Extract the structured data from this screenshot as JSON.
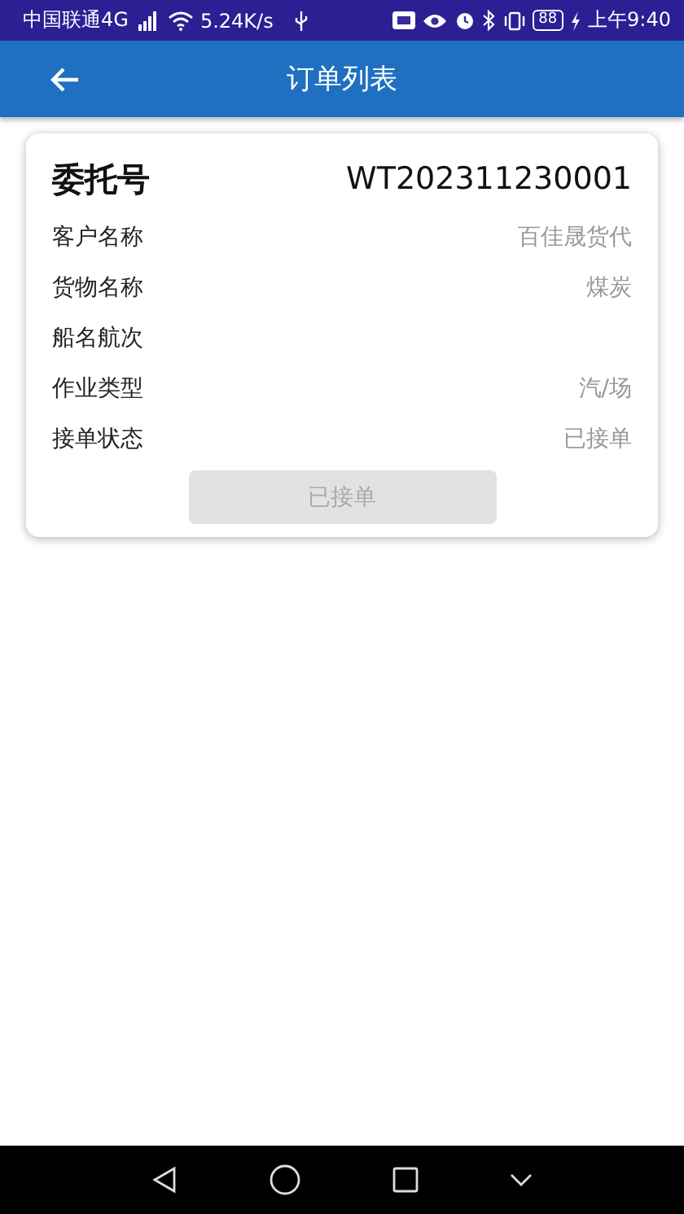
{
  "status_bar": {
    "carrier": "中国联通4G",
    "speed": "5.24K/s",
    "battery": "88",
    "time": "上午9:40"
  },
  "app_bar": {
    "title": "订单列表"
  },
  "orders": [
    {
      "title_label": "委托号",
      "order_no": "WT202311230001",
      "fields": [
        {
          "label": "客户名称",
          "value": "百佳晟货代"
        },
        {
          "label": "货物名称",
          "value": "煤炭"
        },
        {
          "label": "船名航次"
        },
        {
          "label": "作业类型",
          "value": "汽/场"
        },
        {
          "label": "接单状态",
          "value": "已接单"
        }
      ],
      "button": {
        "label": "已接单",
        "disabled": true
      }
    }
  ]
}
